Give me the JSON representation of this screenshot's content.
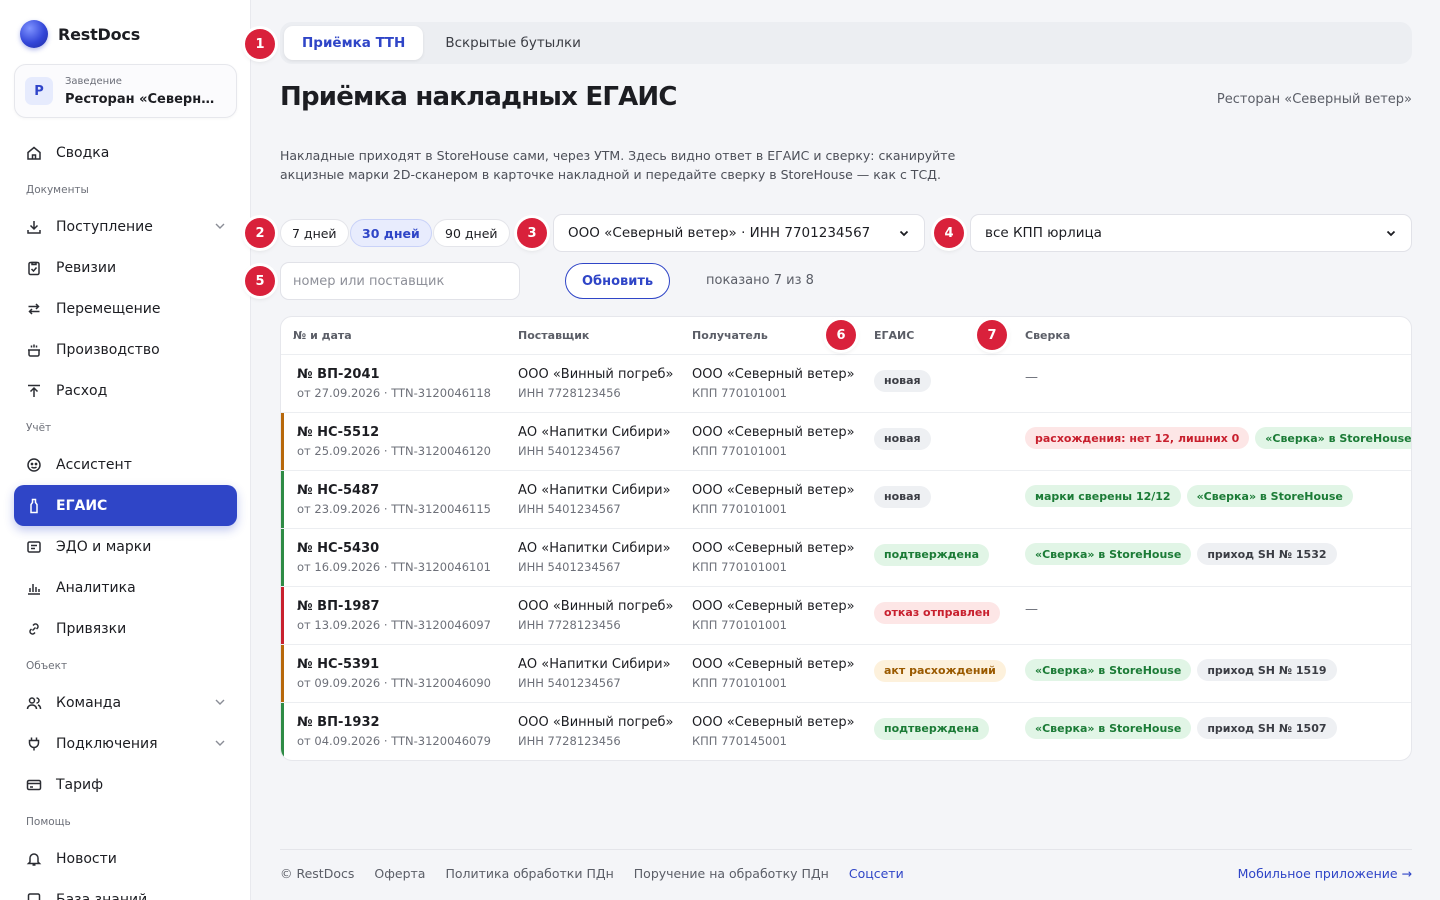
{
  "brand": {
    "name": "RestDocs"
  },
  "venue": {
    "label": "Заведение",
    "avatar": "Р",
    "name": "Ресторан «Северный ветер»"
  },
  "nav": {
    "summary": "Сводка",
    "section_docs": "Документы",
    "income": "Поступление",
    "revisions": "Ревизии",
    "transfer": "Перемещение",
    "production": "Производство",
    "expense": "Расход",
    "section_account": "Учёт",
    "assistant": "Ассистент",
    "egais": "ЕГАИС",
    "edo": "ЭДО и марки",
    "analytics": "Аналитика",
    "bindings": "Привязки",
    "section_object": "Объект",
    "team": "Команда",
    "connections": "Подключения",
    "tariff": "Тариф",
    "section_help": "Помощь",
    "news": "Новости",
    "kb": "База знаний"
  },
  "tabs": [
    "Приёмка ТТН",
    "Вскрытые бутылки"
  ],
  "page": {
    "title": "Приёмка накладных ЕГАИС",
    "venue": "Ресторан «Северный ветер»",
    "description": "Накладные приходят в StoreHouse сами, через УТМ. Здесь видно ответ в ЕГАИС и сверку: сканируйте акцизные марки 2D-сканером в карточке накладной и передайте сверку в StoreHouse — как с ТСД."
  },
  "filters": {
    "periods": [
      "7 дней",
      "30 дней",
      "90 дней"
    ],
    "active_period": "30 дней",
    "org": "ООО «Северный ветер» · ИНН 7701234567",
    "kpp": "все КПП юрлица",
    "search_placeholder": "номер или поставщик",
    "refresh": "Обновить",
    "shown": "показано 7 из 8"
  },
  "badges": [
    "1",
    "2",
    "3",
    "4",
    "5",
    "6",
    "7"
  ],
  "table": {
    "headers": {
      "num": "№ и дата",
      "supplier": "Поставщик",
      "receiver": "Получатель",
      "egais": "ЕГАИС",
      "check": "Сверка"
    },
    "rows": [
      {
        "num": "№ ВП-2041",
        "date": "от 27.09.2026 · TTN-3120046118",
        "supplier": "ООО «Винный погреб»",
        "supplier_inn": "ИНН 7728123456",
        "receiver": "ООО «Северный ветер»",
        "receiver_kpp": "КПП 770101001",
        "status": "новая",
        "status_color": "gray",
        "stripe": "",
        "checks": [],
        "dash": "—"
      },
      {
        "num": "№ НС-5512",
        "date": "от 25.09.2026 · TTN-3120046120",
        "supplier": "АО «Напитки Сибири»",
        "supplier_inn": "ИНН 5401234567",
        "receiver": "ООО «Северный ветер»",
        "receiver_kpp": "КПП 770101001",
        "status": "новая",
        "status_color": "gray",
        "stripe": "#b7680b",
        "checks": [
          {
            "text": "расхождения: нет 12, лишних 0",
            "color": "red"
          },
          {
            "text": "«Сверка» в StoreHouse",
            "color": "green"
          }
        ]
      },
      {
        "num": "№ НС-5487",
        "date": "от 23.09.2026 · TTN-3120046115",
        "supplier": "АО «Напитки Сибири»",
        "supplier_inn": "ИНН 5401234567",
        "receiver": "ООО «Северный ветер»",
        "receiver_kpp": "КПП 770101001",
        "status": "новая",
        "status_color": "gray",
        "stripe": "#2e8b45",
        "checks": [
          {
            "text": "марки сверены 12/12",
            "color": "green"
          },
          {
            "text": "«Сверка» в StoreHouse",
            "color": "green"
          }
        ]
      },
      {
        "num": "№ НС-5430",
        "date": "от 16.09.2026 · TTN-3120046101",
        "supplier": "АО «Напитки Сибири»",
        "supplier_inn": "ИНН 5401234567",
        "receiver": "ООО «Северный ветер»",
        "receiver_kpp": "КПП 770101001",
        "status": "подтверждена",
        "status_color": "green",
        "stripe": "#2e8b45",
        "checks": [
          {
            "text": "«Сверка» в StoreHouse",
            "color": "green"
          },
          {
            "text": "приход SH № 1532",
            "color": "gray"
          }
        ]
      },
      {
        "num": "№ ВП-1987",
        "date": "от 13.09.2026 · TTN-3120046097",
        "supplier": "ООО «Винный погреб»",
        "supplier_inn": "ИНН 7728123456",
        "receiver": "ООО «Северный ветер»",
        "receiver_kpp": "КПП 770101001",
        "status": "отказ отправлен",
        "status_color": "red",
        "stripe": "#c8202e",
        "checks": [],
        "dash": "—"
      },
      {
        "num": "№ НС-5391",
        "date": "от 09.09.2026 · TTN-3120046090",
        "supplier": "АО «Напитки Сибири»",
        "supplier_inn": "ИНН 5401234567",
        "receiver": "ООО «Северный ветер»",
        "receiver_kpp": "КПП 770101001",
        "status": "акт расхождений",
        "status_color": "orange",
        "stripe": "#b7680b",
        "checks": [
          {
            "text": "«Сверка» в StoreHouse",
            "color": "green"
          },
          {
            "text": "приход SH № 1519",
            "color": "gray"
          }
        ]
      },
      {
        "num": "№ ВП-1932",
        "date": "от 04.09.2026 · TTN-3120046079",
        "supplier": "ООО «Винный погреб»",
        "supplier_inn": "ИНН 7728123456",
        "receiver": "ООО «Северный ветер»",
        "receiver_kpp": "КПП 770145001",
        "status": "подтверждена",
        "status_color": "green",
        "stripe": "#2e8b45",
        "checks": [
          {
            "text": "«Сверка» в StoreHouse",
            "color": "green"
          },
          {
            "text": "приход SH № 1507",
            "color": "gray"
          }
        ]
      }
    ]
  },
  "footer": {
    "copyright": "© RestDocs",
    "offer": "Оферта",
    "privacy": "Политика обработки ПДн",
    "order": "Поручение на обработку ПДн",
    "social": "Соцсети",
    "mobile": "Мобильное приложение →"
  }
}
